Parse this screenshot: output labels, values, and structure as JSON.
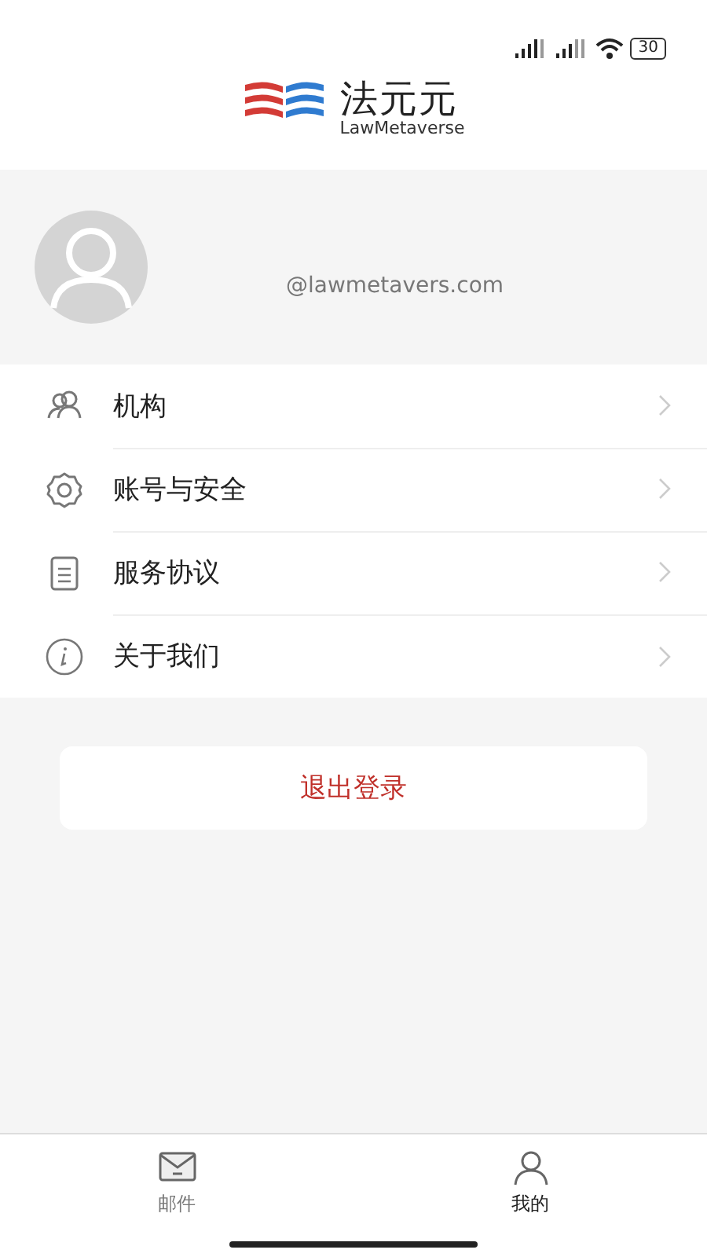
{
  "status_bar": {
    "battery": "30"
  },
  "logo": {
    "title": "法元元",
    "subtitle": "LawMetaverse"
  },
  "profile": {
    "email": "@lawmetavers.com"
  },
  "menu": [
    {
      "kind": "people",
      "label": "机构"
    },
    {
      "kind": "gear",
      "label": "账号与安全"
    },
    {
      "kind": "document",
      "label": "服务协议"
    },
    {
      "kind": "info",
      "label": "关于我们"
    }
  ],
  "logout_button": "退出登录",
  "tab_bar": [
    {
      "kind": "mail",
      "label": "邮件",
      "selected": false
    },
    {
      "kind": "person",
      "label": "我的",
      "selected": true
    }
  ]
}
